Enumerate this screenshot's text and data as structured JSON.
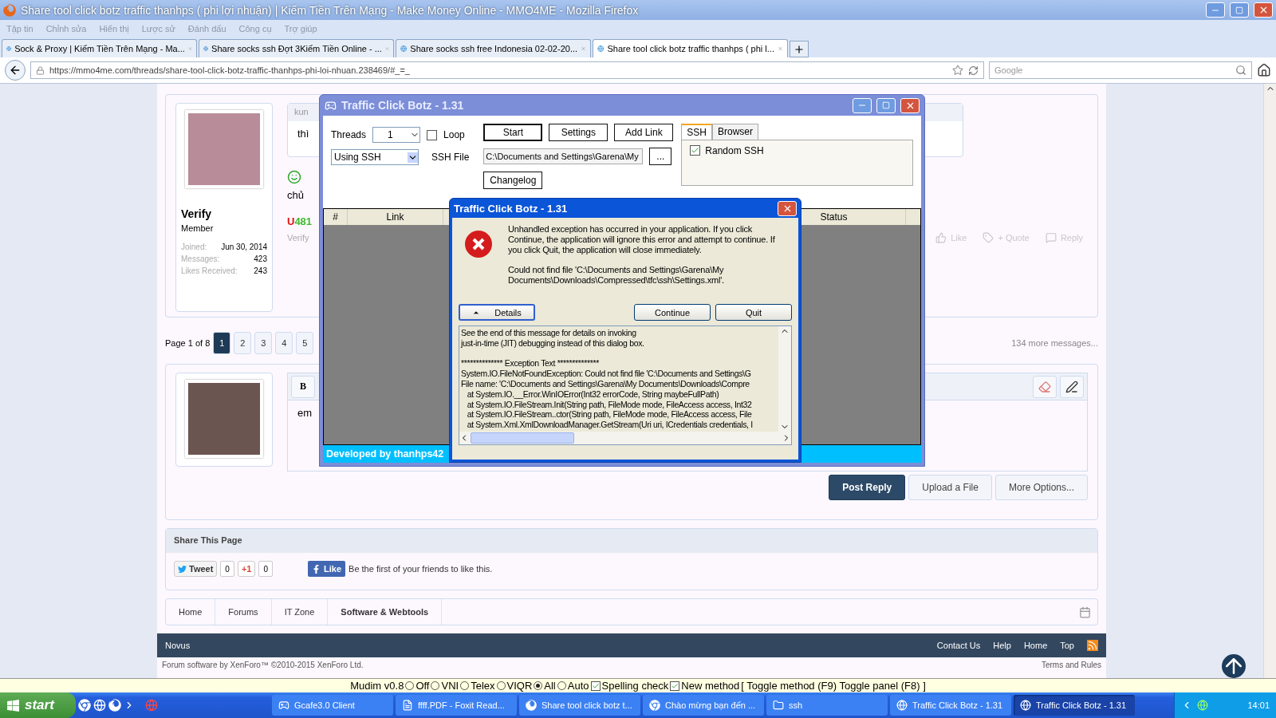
{
  "browser": {
    "title": "Share tool click botz traffic thanhps ( phi lợi nhuận) | Kiếm Tiền Trên Mạng - Make Money Online - MMO4ME - Mozilla Firefox",
    "menu": [
      "Tập tin",
      "Chỉnh sửa",
      "Hiển thị",
      "Lược sử",
      "Đánh dấu",
      "Công cụ",
      "Trợ giúp"
    ],
    "tabs": [
      {
        "label": "Sock & Proxy | Kiếm Tiền Trên Mạng - Ma...",
        "selected": false
      },
      {
        "label": "Share socks ssh Đợt 3Kiếm Tiền Online - ...",
        "selected": false
      },
      {
        "label": "Share socks ssh free Indonesia 02-02-20...",
        "selected": false
      },
      {
        "label": "Share tool click botz traffic thanhps ( phi l...",
        "selected": true
      }
    ],
    "url": "https://mmo4me.com/threads/share-tool-click-botz-traffic-thanhps-phi-loi-nhuan.238469/#_=_",
    "search_placeholder": "Google"
  },
  "forum": {
    "post": {
      "quote_author": "kun",
      "quote_text": "thì",
      "message": "chủ",
      "signature": "U481",
      "author_meta": "Verify",
      "actions": [
        "Like",
        "+ Quote",
        "Reply"
      ]
    },
    "user": {
      "name": "Verify",
      "title": "Member",
      "stats": [
        {
          "label": "Joined:",
          "value": "Jun 30, 2014"
        },
        {
          "label": "Messages:",
          "value": "423"
        },
        {
          "label": "Likes Received:",
          "value": "243"
        }
      ]
    },
    "pagination": {
      "label": "Page 1 of 8",
      "pages": [
        {
          "label": "1",
          "selected": true
        },
        {
          "label": "2",
          "selected": false
        },
        {
          "label": "3",
          "selected": false
        },
        {
          "label": "4",
          "selected": false
        },
        {
          "label": "5",
          "selected": false
        }
      ],
      "more": "134 more messages..."
    },
    "editor": {
      "bold": "B",
      "text": "em"
    },
    "reply_buttons": [
      "Post Reply",
      "Upload a File",
      "More Options..."
    ],
    "share": {
      "title": "Share This Page",
      "tweet": "Tweet",
      "tweet_count": "0",
      "gplus": "+1",
      "gplus_count": "0",
      "like": "Like",
      "like_text": "Be the first of your friends to like this."
    },
    "breadcrumb": [
      "Home",
      "Forums",
      "IT Zone",
      "Software & Webtools"
    ],
    "footer": {
      "brand": "Novus",
      "links": [
        "Contact Us",
        "Help",
        "Home",
        "Top"
      ]
    },
    "credits": "Forum software by XenForo™ ©2010-2015 XenForo Ltd.",
    "terms": "Terms and Rules"
  },
  "bot": {
    "title": "Traffic Click Botz - 1.31",
    "threads_label": "Threads",
    "threads_value": "1",
    "loop": {
      "label": "Loop",
      "checked": false
    },
    "mode": "Using SSH",
    "ssh_file_label": "SSH File",
    "ssh_file_path": "C:\\Documents and Settings\\Garena\\My",
    "browse": "...",
    "buttons": [
      "Start",
      "Settings",
      "Add Link"
    ],
    "changelog": "Changelog",
    "tabs": [
      {
        "label": "SSH",
        "selected": true
      },
      {
        "label": "Browser",
        "selected": false
      }
    ],
    "random_ssh": {
      "label": "Random SSH",
      "checked": true
    },
    "columns": [
      "#",
      "Link",
      "Status"
    ],
    "footer": "Developed by thanhps42"
  },
  "dialog": {
    "title": "Traffic Click Botz - 1.31",
    "message": "Unhandled exception has occurred in your application. If you click Continue, the application will ignore this error and attempt to continue. If you click Quit, the application will close immediately.",
    "detail": "Could not find file 'C:\\Documents and Settings\\Garena\\My Documents\\Downloads\\Compressed\\tfc\\ssh\\Settings.xml'.",
    "details_button": "Details",
    "buttons": [
      "Continue",
      "Quit"
    ],
    "details_intro": [
      "See the end of this message for details on invoking",
      "just-in-time (JIT) debugging instead of this dialog box."
    ],
    "details_lines": [
      "************** Exception Text **************",
      "System.IO.FileNotFoundException: Could not find file 'C:\\Documents and Settings\\G",
      "File name: 'C:\\Documents and Settings\\Garena\\My Documents\\Downloads\\Compre",
      "   at System.IO.__Error.WinIOError(Int32 errorCode, String maybeFullPath)",
      "   at System.IO.FileStream.Init(String path, FileMode mode, FileAccess access, Int32",
      "   at System.IO.FileStream..ctor(String path, FileMode mode, FileAccess access, File",
      "   at System.Xml.XmlDownloadManager.GetStream(Uri uri, ICredentials credentials, I"
    ]
  },
  "mudim": {
    "name": "Mudim v0.8",
    "options": [
      {
        "kind": "radio",
        "label": "Off",
        "selected": false
      },
      {
        "kind": "radio",
        "label": "VNI",
        "selected": false
      },
      {
        "kind": "radio",
        "label": "Telex",
        "selected": false
      },
      {
        "kind": "radio",
        "label": "VIQR",
        "selected": false
      },
      {
        "kind": "radio",
        "label": "All",
        "selected": true
      },
      {
        "kind": "radio",
        "label": "Auto",
        "selected": false
      },
      {
        "kind": "checkbox",
        "label": "Spelling check",
        "checked": true
      },
      {
        "kind": "checkbox",
        "label": "New method",
        "checked": true
      }
    ],
    "hint": "[ Toggle method (F9) Toggle panel (F8) ]"
  },
  "taskbar": {
    "start": "start",
    "items": [
      {
        "label": "Gcafe3.0 Client",
        "selected": false
      },
      {
        "label": "ffff.PDF - Foxit Read...",
        "selected": false
      },
      {
        "label": "Share tool click botz t...",
        "selected": false
      },
      {
        "label": "Chào mừng bạn đến ...",
        "selected": false
      },
      {
        "label": "ssh",
        "selected": false
      },
      {
        "label": "Traffic Click Botz - 1.31",
        "selected": false
      },
      {
        "label": "Traffic Click Botz - 1.31",
        "selected": true
      }
    ],
    "time": "14:01"
  }
}
